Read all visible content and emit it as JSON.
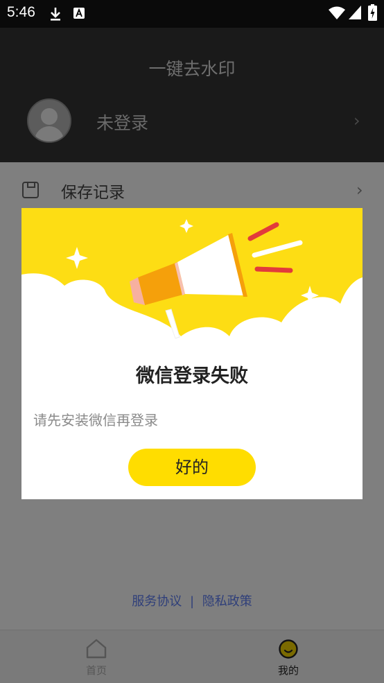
{
  "status_bar": {
    "time": "5:46",
    "download_icon": "download-icon",
    "a_icon": "text-a-icon",
    "wifi_icon": "wifi-icon",
    "signal_icon": "signal-icon",
    "battery_icon": "battery-charging-icon"
  },
  "header": {
    "title": "一键去水印",
    "login_status": "未登录"
  },
  "menu": {
    "items": [
      {
        "label": "保存记录",
        "icon": "save-icon"
      }
    ]
  },
  "dialog": {
    "title": "微信登录失败",
    "message": "请先安装微信再登录",
    "ok_label": "好的",
    "accent": "#ffdd00"
  },
  "footer_links": {
    "service": "服务协议",
    "separator": "|",
    "privacy": "隐私政策"
  },
  "bottom_nav": {
    "tabs": [
      {
        "label": "首页",
        "icon": "home-icon"
      },
      {
        "label": "我的",
        "icon": "profile-face-icon"
      }
    ]
  }
}
